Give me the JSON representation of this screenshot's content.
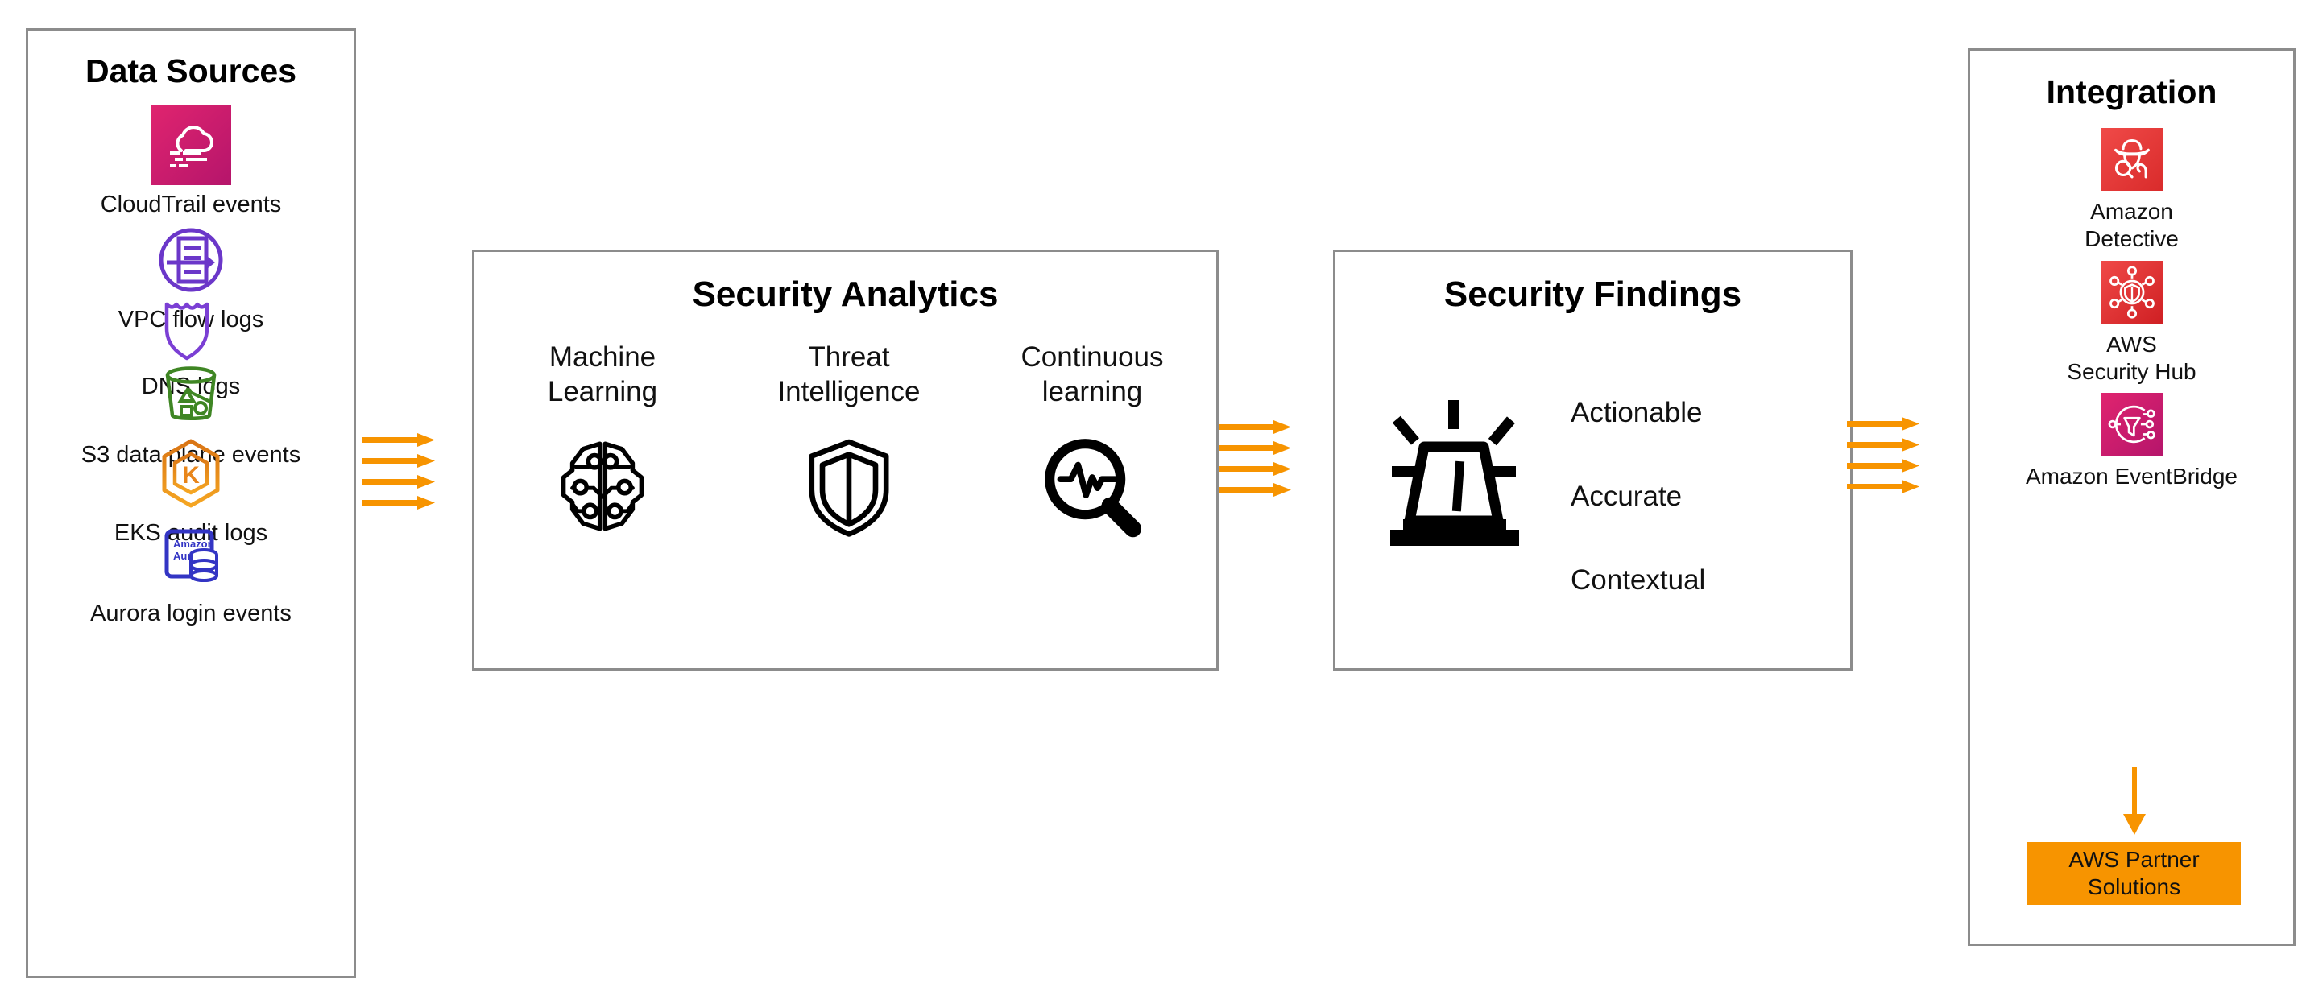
{
  "colors": {
    "accent_orange": "#f79400",
    "panel_border": "#8c8c8c",
    "cloudtrail_pink": "#cf2271",
    "vpc_purple": "#6b37c9",
    "dns_purple": "#7b3fd4",
    "s3_green": "#3f8624",
    "eks_orange": "#e8851a",
    "aurora_blue": "#3335c4",
    "detective_red": "#e8393a",
    "securityhub_red": "#e8393a",
    "eventbridge_pink": "#d4246e",
    "partner_orange": "#f79400",
    "icon_black": "#000000"
  },
  "data_sources": {
    "title": "Data Sources",
    "items": [
      {
        "label": "CloudTrail events",
        "icon": "cloudtrail-icon"
      },
      {
        "label": "VPC flow logs",
        "icon": "vpc-flow-logs-icon"
      },
      {
        "label": "DNS logs",
        "icon": "dns-shield-icon"
      },
      {
        "label": "S3 data plane events",
        "icon": "s3-bucket-icon"
      },
      {
        "label": "EKS audit logs",
        "icon": "eks-hexagon-icon"
      },
      {
        "label": "Aurora login events",
        "icon": "amazon-aurora-icon"
      }
    ]
  },
  "security_analytics": {
    "title": "Security Analytics",
    "columns": [
      {
        "label": "Machine\nLearning",
        "icon": "neural-brain-icon"
      },
      {
        "label": "Threat\nIntelligence",
        "icon": "shield-icon"
      },
      {
        "label": "Continuous\nlearning",
        "icon": "magnifier-pulse-icon"
      }
    ]
  },
  "security_findings": {
    "title": "Security Findings",
    "icon": "alert-siren-icon",
    "attributes": [
      "Actionable",
      "Accurate",
      "Contextual"
    ]
  },
  "integration": {
    "title": "Integration",
    "items": [
      {
        "label": "Amazon\nDetective",
        "icon": "amazon-detective-icon"
      },
      {
        "label": "AWS\nSecurity Hub",
        "icon": "aws-security-hub-icon"
      },
      {
        "label": "Amazon EventBridge",
        "icon": "amazon-eventbridge-icon"
      }
    ],
    "partner_box": {
      "label": "AWS Partner\nSolutions"
    },
    "downstream_arrow": "down-arrow-icon"
  },
  "flows": [
    {
      "name": "data-sources-to-analytics",
      "arrow_count": 4
    },
    {
      "name": "analytics-to-findings",
      "arrow_count": 4
    },
    {
      "name": "findings-to-integration",
      "arrow_count": 4
    }
  ]
}
